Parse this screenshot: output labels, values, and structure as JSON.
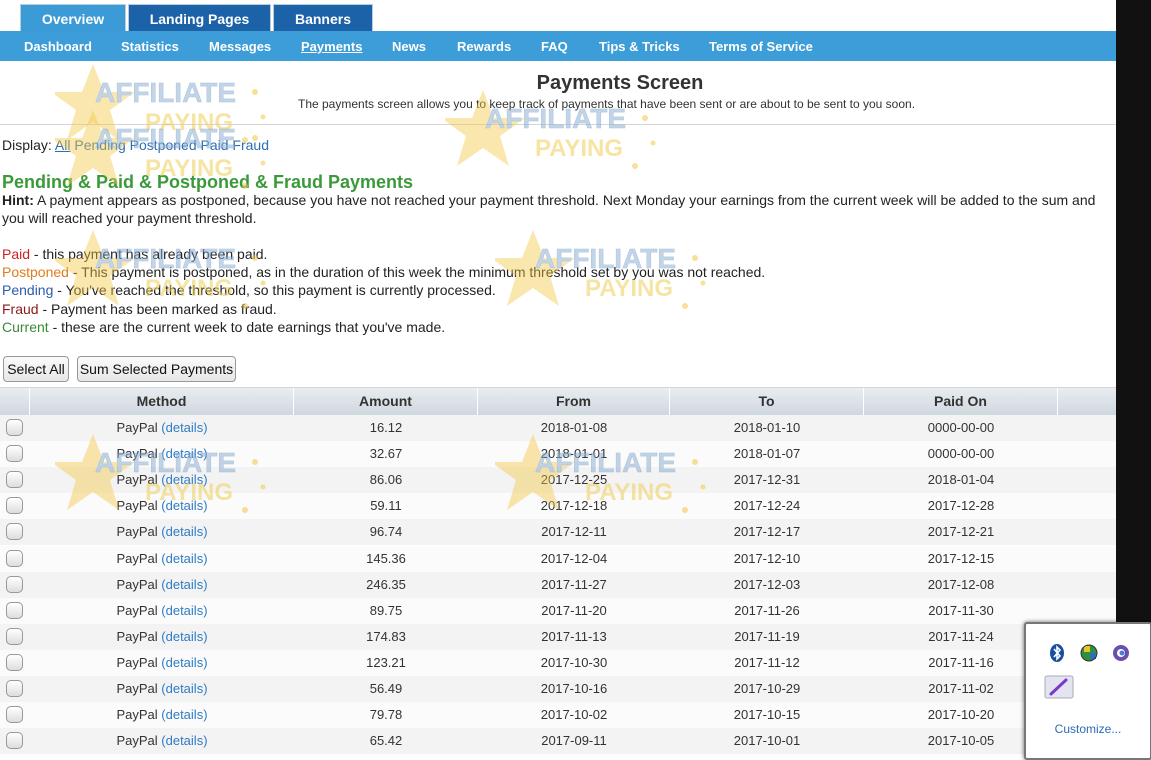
{
  "top_tabs": [
    {
      "label": "Overview",
      "active": true
    },
    {
      "label": "Landing Pages",
      "active": false
    },
    {
      "label": "Banners",
      "active": false
    }
  ],
  "subnav": [
    {
      "label": "Dashboard"
    },
    {
      "label": "Statistics"
    },
    {
      "label": "Messages"
    },
    {
      "label": "Payments",
      "active": true
    },
    {
      "label": "News"
    },
    {
      "label": "Rewards"
    },
    {
      "label": "FAQ"
    },
    {
      "label": "Tips & Tricks"
    },
    {
      "label": "Terms of Service"
    }
  ],
  "header": {
    "title": "Payments Screen",
    "description": "The payments screen allows you to keep track of payments that have been sent or are about to be sent to you soon."
  },
  "display": {
    "label": "Display:",
    "options": [
      "All",
      "Pending",
      "Postponed",
      "Paid",
      "Fraud"
    ],
    "active": "All"
  },
  "section_title": "Pending & Paid & Postponed & Fraud Payments",
  "hint": {
    "label": "Hint:",
    "text": " A payment appears as postponed, because you have not reached your payment threshold. Next Monday your earnings from the current week will be added to the sum and you will reached your payment threshold."
  },
  "legend": [
    {
      "term": "Paid",
      "desc": " - this payment has already been paid.",
      "color": "#cc2222"
    },
    {
      "term": "Postponed",
      "desc": " - This payment is postponed, as in the duration of this week the minimum threshold set by you was not reached.",
      "color": "#e07c1a"
    },
    {
      "term": "Pending",
      "desc": " - You've reached the threshold, so this payment is currently processed.",
      "color": "#2a5bb0"
    },
    {
      "term": "Fraud",
      "desc": " - Payment has been marked as fraud.",
      "color": "#8b1a1a"
    },
    {
      "term": "Current",
      "desc": " - these are the current week to date earnings that you've made.",
      "color": "#3a8a3a"
    }
  ],
  "buttons": {
    "select_all": "Select All",
    "sum_selected": "Sum Selected Payments"
  },
  "table": {
    "headers": [
      "Method",
      "Amount",
      "From",
      "To",
      "Paid On"
    ],
    "details_label": "(details)",
    "rows": [
      {
        "method": "PayPal",
        "amount": "16.12",
        "from": "2018-01-08",
        "to": "2018-01-10",
        "paid_on": "0000-00-00"
      },
      {
        "method": "PayPal",
        "amount": "32.67",
        "from": "2018-01-01",
        "to": "2018-01-07",
        "paid_on": "0000-00-00"
      },
      {
        "method": "PayPal",
        "amount": "86.06",
        "from": "2017-12-25",
        "to": "2017-12-31",
        "paid_on": "2018-01-04"
      },
      {
        "method": "PayPal",
        "amount": "59.11",
        "from": "2017-12-18",
        "to": "2017-12-24",
        "paid_on": "2017-12-28"
      },
      {
        "method": "PayPal",
        "amount": "96.74",
        "from": "2017-12-11",
        "to": "2017-12-17",
        "paid_on": "2017-12-21"
      },
      {
        "method": "PayPal",
        "amount": "145.36",
        "from": "2017-12-04",
        "to": "2017-12-10",
        "paid_on": "2017-12-15"
      },
      {
        "method": "PayPal",
        "amount": "246.35",
        "from": "2017-11-27",
        "to": "2017-12-03",
        "paid_on": "2017-12-08"
      },
      {
        "method": "PayPal",
        "amount": "89.75",
        "from": "2017-11-20",
        "to": "2017-11-26",
        "paid_on": "2017-11-30"
      },
      {
        "method": "PayPal",
        "amount": "174.83",
        "from": "2017-11-13",
        "to": "2017-11-19",
        "paid_on": "2017-11-24"
      },
      {
        "method": "PayPal",
        "amount": "123.21",
        "from": "2017-10-30",
        "to": "2017-11-12",
        "paid_on": "2017-11-16"
      },
      {
        "method": "PayPal",
        "amount": "56.49",
        "from": "2017-10-16",
        "to": "2017-10-29",
        "paid_on": "2017-11-02"
      },
      {
        "method": "PayPal",
        "amount": "79.78",
        "from": "2017-10-02",
        "to": "2017-10-15",
        "paid_on": "2017-10-20"
      },
      {
        "method": "PayPal",
        "amount": "65.42",
        "from": "2017-09-11",
        "to": "2017-10-01",
        "paid_on": "2017-10-05"
      }
    ]
  },
  "watermark": {
    "line1": "AFFILIATE",
    "line2": "PAYING"
  },
  "tray": {
    "icons": [
      "bluetooth-icon",
      "network-globe-icon",
      "browser-icon",
      "pen-tablet-icon"
    ],
    "customize_label": "Customize..."
  }
}
